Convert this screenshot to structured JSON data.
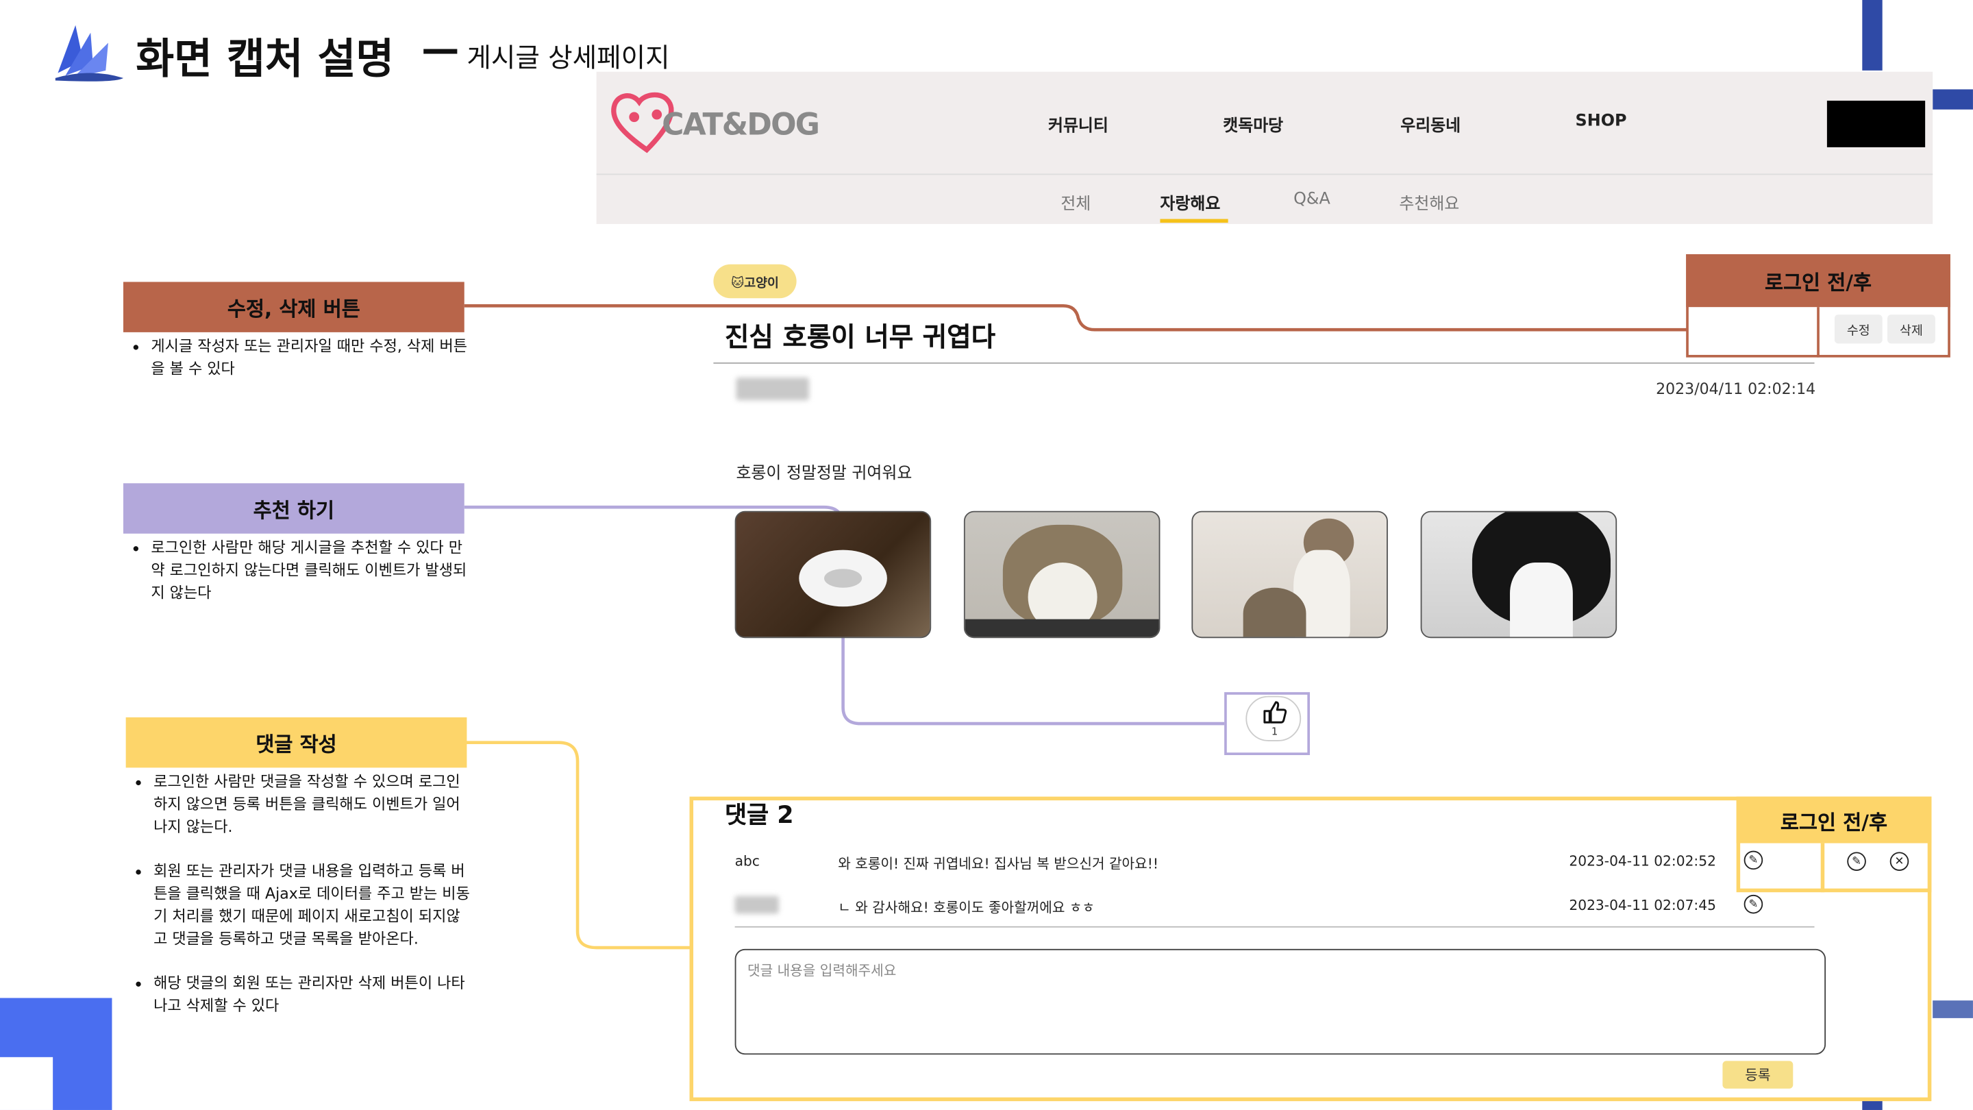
{
  "slide": {
    "title": "화면 캡처 설명",
    "dash": "—",
    "subtitle": "게시글 상세페이지"
  },
  "site": {
    "logo_text": "CAT&DOG",
    "nav": [
      "커뮤니티",
      "캣독마당",
      "우리동네",
      "SHOP"
    ],
    "subnav": [
      "전체",
      "자랑해요",
      "Q&A",
      "추천해요"
    ],
    "subnav_active": "자랑해요"
  },
  "callouts": {
    "edit": {
      "title": "수정, 삭제 버튼",
      "color": "#b8654a",
      "items": [
        "게시글 작성자 또는 관리자일 때만 수정, 삭제 버튼을 볼 수 있다"
      ]
    },
    "recommend": {
      "title": "추천 하기",
      "color": "#b3a8db",
      "items": [
        "로그인한 사람만 해당 게시글을 추천할 수 있다 만약 로그인하지 않는다면 클릭해도 이벤트가 발생되지 않는다"
      ]
    },
    "comment": {
      "title": "댓글 작성",
      "color": "#fdd56a",
      "items": [
        "로그인한 사람만 댓글을 작성할 수 있으며 로그인하지 않으면 등록 버튼을 클릭해도 이벤트가 일어나지 않는다.",
        "회원 또는 관리자가 댓글 내용을 입력하고 등록 버튼을 클릭했을 때 Ajax로 데이터를 주고 받는 비동기 처리를 했기 때문에 페이지 새로고침이 되지않고 댓글을 등록하고 댓글 목록을 받아온다.",
        "해당 댓글의 회원 또는 관리자만 삭제 버튼이 나타나고 삭제할 수 있다"
      ]
    }
  },
  "post": {
    "tag": "🐱고양이",
    "title": "진심 호롱이 너무 귀엽다",
    "date": "2023/04/11 02:02:14",
    "body": "호롱이 정말정말 귀여워요",
    "like_count": "1",
    "edit_label": "수정",
    "delete_label": "삭제",
    "login_before_after": "로그인 전/후"
  },
  "comments": {
    "heading": "댓글 2",
    "login_before_after": "로그인 전/후",
    "rows": [
      {
        "author": "abc",
        "text": "와 호롱이! 진짜 귀엽네요! 집사님 복 받으신거 같아요!!",
        "date": "2023-04-11 02:02:52"
      },
      {
        "author": "",
        "text": "ㄴ 와 감사해요! 호롱이도 좋아할꺼에요 ㅎㅎ",
        "date": "2023-04-11 02:07:45"
      }
    ],
    "input_placeholder": "댓글 내용을 입력해주세요",
    "submit_label": "등록"
  }
}
